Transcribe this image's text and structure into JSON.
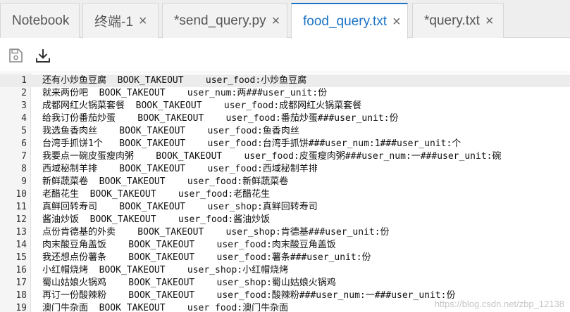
{
  "tabs": [
    {
      "label": "Notebook",
      "closable": false,
      "active": false
    },
    {
      "label": "终端-1",
      "closable": true,
      "active": false
    },
    {
      "label": "*send_query.py",
      "closable": true,
      "active": false
    },
    {
      "label": "food_query.txt",
      "closable": true,
      "active": true
    },
    {
      "label": "*query.txt",
      "closable": true,
      "active": false
    }
  ],
  "close_glyph": "×",
  "toolbar": {
    "save_icon": "save-icon",
    "download_icon": "download-icon"
  },
  "editor": {
    "lines": [
      {
        "n": "1",
        "text": "还有小炒鱼豆腐  BOOK_TAKEOUT    user_food:小炒鱼豆腐"
      },
      {
        "n": "2",
        "text": "就来两份吧  BOOK_TAKEOUT    user_num:两###user_unit:份"
      },
      {
        "n": "3",
        "text": "成都网红火锅菜套餐  BOOK_TAKEOUT    user_food:成都网红火锅菜套餐"
      },
      {
        "n": "4",
        "text": "给我订份番茄炒蛋    BOOK_TAKEOUT    user_food:番茄炒蛋###user_unit:份"
      },
      {
        "n": "5",
        "text": "我选鱼香肉丝    BOOK_TAKEOUT    user_food:鱼香肉丝"
      },
      {
        "n": "6",
        "text": "台湾手抓饼1个   BOOK_TAKEOUT    user_food:台湾手抓饼###user_num:1###user_unit:个"
      },
      {
        "n": "7",
        "text": "我要点一碗皮蛋瘦肉粥    BOOK_TAKEOUT    user_food:皮蛋瘦肉粥###user_num:一###user_unit:碗"
      },
      {
        "n": "8",
        "text": "西域秘制羊排    BOOK_TAKEOUT    user_food:西域秘制羊排"
      },
      {
        "n": "9",
        "text": "新鲜蔬菜卷  BOOK_TAKEOUT    user_food:新鲜蔬菜卷"
      },
      {
        "n": "10",
        "text": "老醋花生  BOOK_TAKEOUT    user_food:老醋花生"
      },
      {
        "n": "11",
        "text": "真鲜回转寿司    BOOK_TAKEOUT    user_shop:真鲜回转寿司"
      },
      {
        "n": "12",
        "text": "酱油炒饭  BOOK_TAKEOUT    user_food:酱油炒饭"
      },
      {
        "n": "13",
        "text": "点份肯德基的外卖    BOOK_TAKEOUT    user_shop:肯德基###user_unit:份"
      },
      {
        "n": "14",
        "text": "肉末酸豆角盖饭    BOOK_TAKEOUT    user_food:肉末酸豆角盖饭"
      },
      {
        "n": "15",
        "text": "我还想点份薯条    BOOK_TAKEOUT    user_food:薯条###user_unit:份"
      },
      {
        "n": "16",
        "text": "小红帽烧烤  BOOK_TAKEOUT    user_shop:小红帽烧烤"
      },
      {
        "n": "17",
        "text": "蜀山姑娘火锅鸡    BOOK_TAKEOUT    user_shop:蜀山姑娘火锅鸡"
      },
      {
        "n": "18",
        "text": "再订一份酸辣粉    BOOK_TAKEOUT    user_food:酸辣粉###user_num:一###user_unit:份"
      },
      {
        "n": "19",
        "text": "澳门牛杂面  BOOK_TAKEOUT    user_food:澳门牛杂面"
      }
    ],
    "current_line": "1"
  },
  "watermark": "https://blog.csdn.net/zbp_12138",
  "colors": {
    "accent": "#1a73c6",
    "tabbar_bg": "#eeeeee",
    "gutter_bg": "#f5f5f5",
    "current_line_bg": "#ececec"
  }
}
